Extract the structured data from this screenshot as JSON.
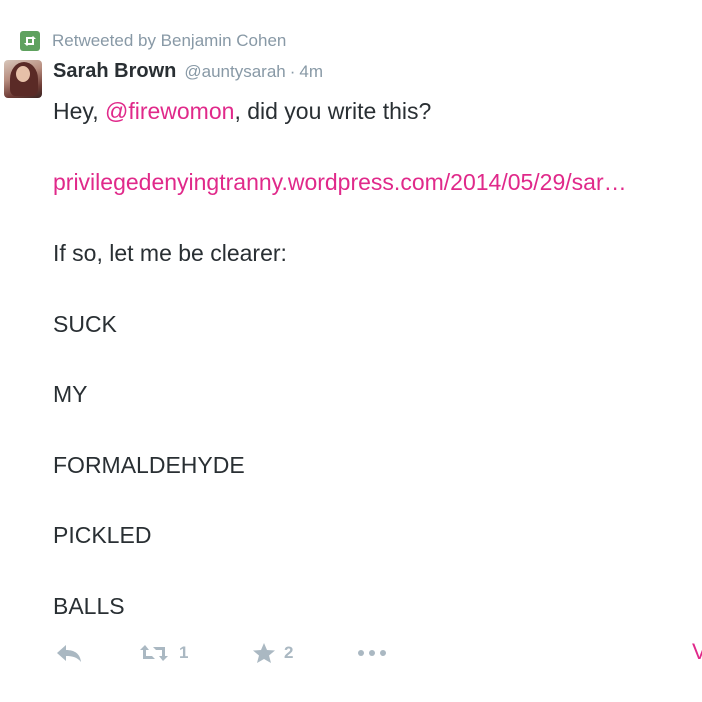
{
  "retweet_context": {
    "icon": "retweet-icon",
    "text": "Retweeted by Benjamin Cohen",
    "color": "#5fa25f"
  },
  "tweet": {
    "display_name": "Sarah Brown",
    "username": "@auntysarah",
    "separator": "·",
    "timestamp": "4m",
    "line1": {
      "pre": "Hey, ",
      "mention": "@firewomon",
      "post": ", did you write this?"
    },
    "link": "privilegedenyingtranny.wordpress.com/2014/05/29/sar…",
    "lines": [
      "If so, let me be clearer:",
      "SUCK",
      "MY",
      "FORMALDEHYDE",
      "PICKLED",
      "BALLS"
    ]
  },
  "actions": {
    "reply_icon": "reply-icon",
    "retweet_icon": "retweet-icon",
    "retweet_count": "1",
    "favorite_icon": "star-icon",
    "favorite_count": "2",
    "more_icon": "more-icon",
    "cut_off_text": "V"
  },
  "colors": {
    "accent": "#e0298a",
    "muted": "#8899a6",
    "action": "#aab8c2",
    "text": "#292f33"
  }
}
